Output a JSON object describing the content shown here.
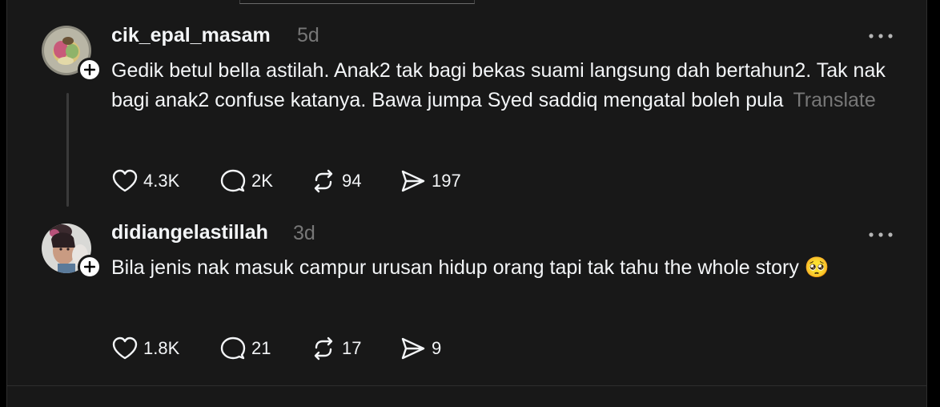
{
  "posts": [
    {
      "username": "cik_epal_masam",
      "time": "5d",
      "text": "Gedik betul bella astilah. Anak2 tak bagi bekas suami langsung dah bertahun2. Tak nak bagi anak2 confuse katanya. Bawa jumpa Syed saddiq mengatal boleh pula",
      "translate_label": "Translate",
      "likes": "4.3K",
      "replies": "2K",
      "reposts": "94",
      "shares": "197"
    },
    {
      "username": "didiangelastillah",
      "time": "3d",
      "text": "Bila jenis nak masuk campur urusan hidup orang tapi tak tahu the whole story",
      "emoji": "🥺",
      "likes": "1.8K",
      "replies": "21",
      "reposts": "17",
      "shares": "9"
    }
  ],
  "icons": {
    "more": "more-dots-icon",
    "like": "heart-icon",
    "reply": "comment-bubble-icon",
    "repost": "repost-arrows-icon",
    "share": "send-icon",
    "follow": "plus-icon"
  },
  "colors": {
    "background": "#181818",
    "text": "#f3f5f7",
    "muted": "#777777"
  }
}
